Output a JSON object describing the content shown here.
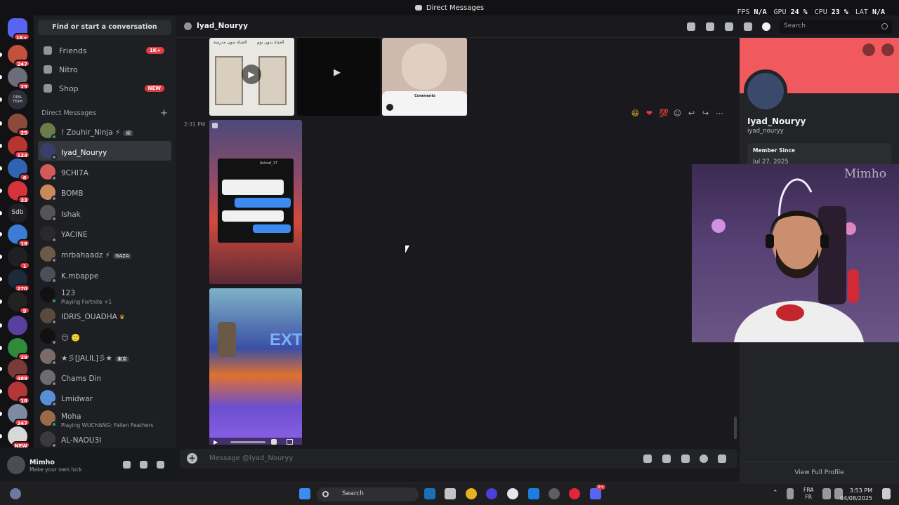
{
  "window": {
    "title": "Direct Messages"
  },
  "overlay": [
    {
      "label": "FPS",
      "value": "N/A"
    },
    {
      "label": "GPU",
      "value": "24 %"
    },
    {
      "label": "CPU",
      "value": "23 %"
    },
    {
      "label": "LAT",
      "value": "N/A"
    }
  ],
  "guilds": [
    {
      "badge": "1K+",
      "color": "#5865f2"
    },
    {
      "badge": "247",
      "color": "#c4513b"
    },
    {
      "badge": "25",
      "color": "#6b6e78"
    },
    {
      "badge": "",
      "label": "OPAL TEAM",
      "color": "#2d2f38"
    },
    {
      "badge": "25",
      "color": "#8a4b3c"
    },
    {
      "badge": "124",
      "color": "#b7352f"
    },
    {
      "badge": "6",
      "color": "#2e64b3"
    },
    {
      "badge": "33",
      "color": "#d6333c"
    },
    {
      "badge": "",
      "label": "Sdb",
      "color": "#1f2024"
    },
    {
      "badge": "18",
      "color": "#3c7bd6"
    },
    {
      "badge": "1",
      "color": "#1f2024"
    },
    {
      "badge": "270",
      "color": "#1d2a3a"
    },
    {
      "badge": "9",
      "color": "#222"
    },
    {
      "badge": "",
      "color": "#5a3f9e"
    },
    {
      "badge": "29",
      "color": "#2f8a3c"
    },
    {
      "badge": "489",
      "color": "#7b3a3a"
    },
    {
      "badge": "18",
      "color": "#b33737"
    },
    {
      "badge": "347",
      "color": "#7c8aa3"
    },
    {
      "badge": "NEW",
      "color": "#d8d8d8"
    }
  ],
  "sidebar": {
    "find_label": "Find or start a conversation",
    "nav": [
      {
        "label": "Friends",
        "pill": "1K+"
      },
      {
        "label": "Nitro",
        "pill": ""
      },
      {
        "label": "Shop",
        "pill": "NEW"
      }
    ],
    "section_title": "Direct Messages",
    "add_symbol": "+",
    "dms": [
      {
        "name": "! Zouhir_Ninja ⚡",
        "tag": "ﷺ",
        "sub": "",
        "color": "#6a7c4a",
        "online": true
      },
      {
        "name": "Iyad_Nouryy",
        "tag": "",
        "sub": "",
        "color": "#3a3f6a",
        "online": false,
        "active": true
      },
      {
        "name": "9CHI7A",
        "tag": "",
        "sub": "",
        "color": "#d45a5a",
        "online": false
      },
      {
        "name": "BOMB",
        "tag": "",
        "sub": "",
        "color": "#c98a5a",
        "online": false
      },
      {
        "name": "Ishak",
        "tag": "",
        "sub": "",
        "color": "#555",
        "online": false
      },
      {
        "name": "YACINE",
        "tag": "",
        "sub": "",
        "color": "#2a2a2a",
        "online": false
      },
      {
        "name": "mrbahaadz ⚡",
        "tag": "GAZA",
        "sub": "",
        "color": "#6b5a45",
        "online": false
      },
      {
        "name": "K.mbappe",
        "tag": "",
        "sub": "",
        "color": "#4b4f58",
        "online": false
      },
      {
        "name": "123",
        "tag": "",
        "sub": "Playing Fortnite +1",
        "color": "#111",
        "online": true
      },
      {
        "name": "IDRIS_OUADHA",
        "tag": "",
        "crown": "♛",
        "sub": "",
        "color": "#5a4a3a",
        "online": false
      },
      {
        "name": "😶 🙂",
        "tag": "",
        "sub": "",
        "color": "#111",
        "online": false
      },
      {
        "name": "★彡[JALIL]彡★",
        "tag": "東京",
        "sub": "",
        "color": "#7a6a6a",
        "online": false
      },
      {
        "name": "Chams Din",
        "tag": "",
        "sub": "",
        "color": "#6d6d6d",
        "online": false
      },
      {
        "name": "Lmidwar",
        "tag": "",
        "sub": "",
        "color": "#5a8fd6",
        "online": false
      },
      {
        "name": "Moha",
        "tag": "",
        "sub": "Playing WUCHANG: Fallen Feathers",
        "color": "#9a6a4a",
        "online": true
      },
      {
        "name": "AL-NAOU3I",
        "tag": "",
        "sub": "",
        "color": "#3a3a3a",
        "online": false
      }
    ]
  },
  "user_panel": {
    "name": "Mimho",
    "status": "Make your own luck"
  },
  "chat": {
    "recipient": "Iyad_Nouryy",
    "timestamp": "2:31 PM",
    "composer_placeholder": "Message @Iyad_Nouryy",
    "search_placeholder": "Search",
    "thumb_texts": {
      "door1": "الحياة بدون مدرسة",
      "door2": "الحياة بدون نوم",
      "chat_name": "Achraf_17",
      "comments": "Comments",
      "sign": "EXT"
    }
  },
  "profile": {
    "display_name": "Iyad_Nouryy",
    "username": "iyad_nouryy",
    "member_since_label": "Member Since",
    "member_since": "Jul 27, 2025",
    "view_full": "View Full Profile",
    "banner_color": "#f05a5f"
  },
  "webcam": {
    "watermark": "Mimho"
  },
  "taskbar": {
    "search": "Search",
    "lang_top": "FRA",
    "lang_bottom": "FR",
    "time": "3:53 PM",
    "date": "04/08/2025",
    "discord_badge": "9+"
  }
}
